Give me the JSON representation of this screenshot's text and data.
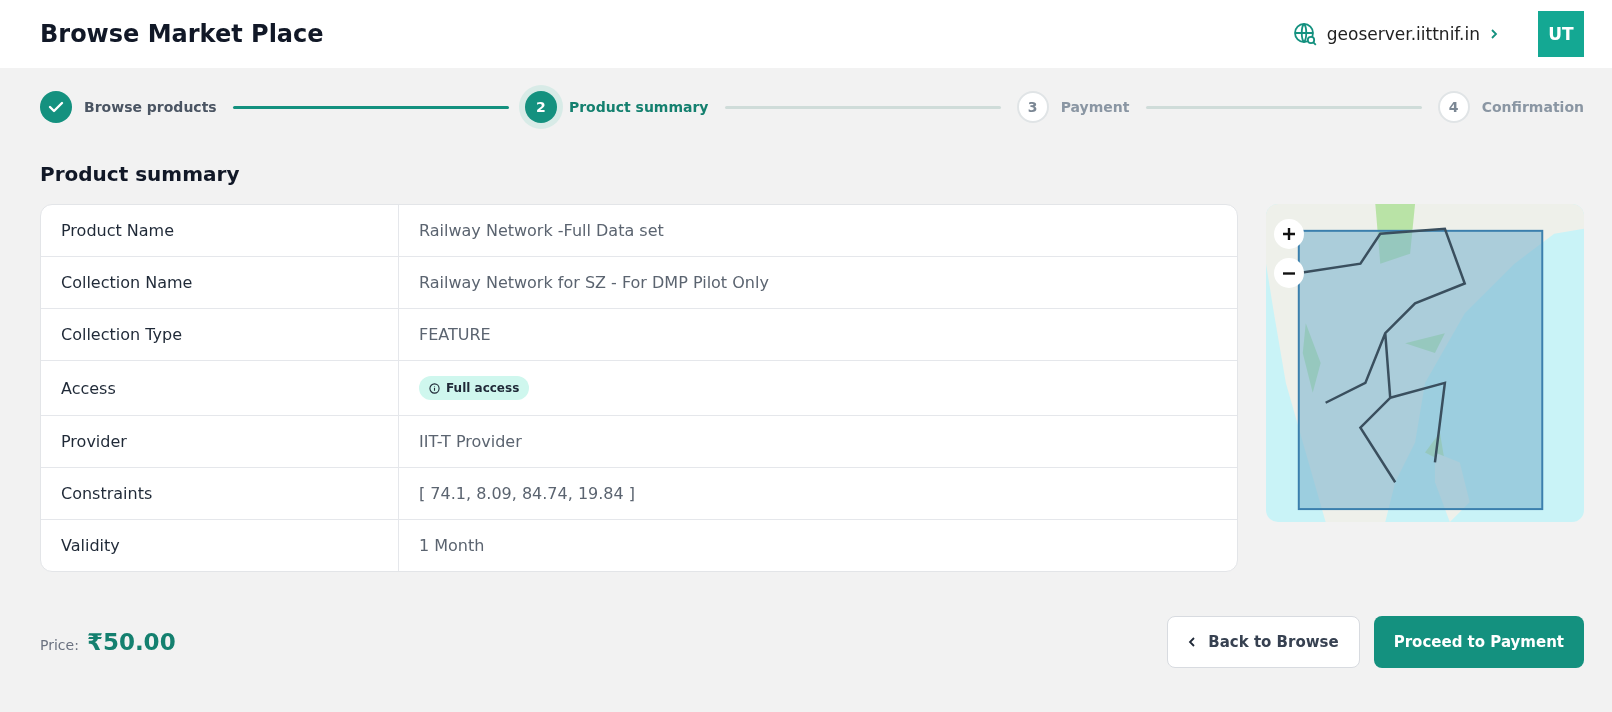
{
  "header": {
    "title": "Browse Market Place",
    "server": "geoserver.iittnif.in",
    "avatar": "UT"
  },
  "steps": [
    {
      "label": "Browse products",
      "kind": "done"
    },
    {
      "number": "2",
      "label": "Product summary",
      "kind": "current"
    },
    {
      "number": "3",
      "label": "Payment",
      "kind": "upcoming"
    },
    {
      "number": "4",
      "label": "Confirmation",
      "kind": "upcoming"
    }
  ],
  "section_title": "Product summary",
  "details": [
    {
      "label": "Product Name",
      "value": "Railway Network -Full Data set",
      "kind": "text"
    },
    {
      "label": "Collection Name",
      "value": "Railway Network for SZ - For DMP Pilot Only",
      "kind": "text"
    },
    {
      "label": "Collection Type",
      "value": "FEATURE",
      "kind": "text"
    },
    {
      "label": "Access",
      "value": "Full access",
      "kind": "badge"
    },
    {
      "label": "Provider",
      "value": "IIT-T Provider",
      "kind": "text"
    },
    {
      "label": "Constraints",
      "value": "[ 74.1, 8.09, 84.74, 19.84 ]",
      "kind": "text"
    },
    {
      "label": "Validity",
      "value": "1 Month",
      "kind": "text"
    }
  ],
  "price": {
    "label": "Price:",
    "amount": "₹50.00"
  },
  "buttons": [
    {
      "label": "Back to Browse",
      "kind": "secondary"
    },
    {
      "label": "Proceed to Payment",
      "kind": "primary"
    }
  ]
}
